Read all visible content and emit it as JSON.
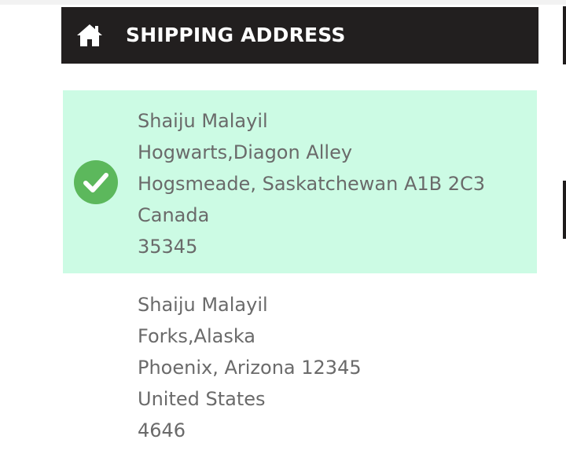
{
  "header": {
    "icon": "home-icon",
    "title": "SHIPPING ADDRESS"
  },
  "colors": {
    "header_bg": "#221f1f",
    "selected_bg": "#ccfbe4",
    "check_green": "#5cb85c",
    "text": "#6a6a6a"
  },
  "addresses": [
    {
      "selected": true,
      "name": "Shaiju Malayil",
      "street": "Hogwarts,Diagon Alley",
      "city_region_postal": "Hogsmeade, Saskatchewan A1B 2C3",
      "country": "Canada",
      "phone": "35345"
    },
    {
      "selected": false,
      "name": "Shaiju Malayil",
      "street": "Forks,Alaska",
      "city_region_postal": "Phoenix, Arizona 12345",
      "country": "United States",
      "phone": "4646"
    }
  ]
}
